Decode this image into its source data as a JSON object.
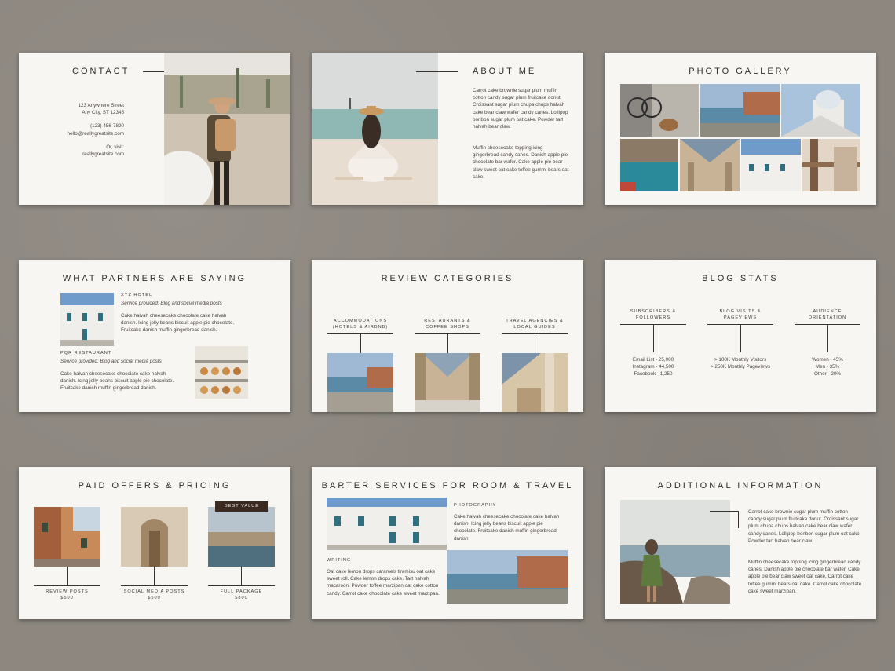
{
  "contact": {
    "title": "CONTACT",
    "address1": "123 Anywhere Street",
    "address2": "Any City, ST 12345",
    "phone": "(123) 456-7890",
    "email": "hello@reallygreatsite.com",
    "visit_label": "Or, visit:",
    "website": "reallygreatsite.com"
  },
  "about": {
    "title": "ABOUT ME",
    "para1": "Carrot cake brownie sugar plum muffin cotton candy sugar plum fruitcake donut. Croissant sugar plum chupa chups halvah cake bear claw wafer candy canes. Lollipop bonbon sugar plum oat cake. Powder tart halvah bear claw.",
    "para2": "Muffin cheesecake topping icing gingerbread candy canes. Danish apple pie chocolate bar wafer. Cake apple pie bear claw sweet oat cake toffee gummi bears oat cake."
  },
  "gallery": {
    "title": "PHOTO GALLERY"
  },
  "partners": {
    "title": "WHAT PARTNERS ARE SAYING",
    "p1_name": "XYZ HOTEL",
    "p1_service": "Service provided: Blog and social media posts",
    "p1_text": "Cake halvah cheesecake chocolate cake halvah danish. Icing jelly beans biscuit apple pie chocolate. Fruitcake danish muffin gingerbread danish.",
    "p2_name": "PQR RESTAURANT",
    "p2_service": "Service provided: Blog and social media posts",
    "p2_text": "Cake halvah cheesecake chocolate cake halvah danish. Icing jelly beans biscuit apple pie chocolate. Fruitcake danish muffin gingerbread danish."
  },
  "review": {
    "title": "REVIEW CATEGORIES",
    "cat1": "ACCOMMODATIONS (HOTELS & AIRBNB)",
    "cat2": "RESTAURANTS & COFFEE SHOPS",
    "cat3": "TRAVEL AGENCIES & LOCAL GUIDES"
  },
  "stats": {
    "title": "BLOG STATS",
    "h1": "SUBSCRIBERS & FOLLOWERS",
    "h2": "BLOG VISITS & PAGEVIEWS",
    "h3": "AUDIENCE ORIENTATION",
    "c1": [
      "Email List - 25,000",
      "Instagram - 44,500",
      "Facebook - 1,250"
    ],
    "c2": [
      "> 100K Monthly Visitors",
      "> 250K Monthly Pageviews"
    ],
    "c3": [
      "Women - 45%",
      "Men - 35%",
      "Other - 20%"
    ]
  },
  "pricing": {
    "title": "PAID OFFERS & PRICING",
    "badge": "BEST VALUE",
    "o1_label": "REVIEW POSTS",
    "o1_price": "$500",
    "o2_label": "SOCIAL MEDIA POSTS",
    "o2_price": "$500",
    "o3_label": "FULL PACKAGE",
    "o3_price": "$800"
  },
  "barter": {
    "title": "BARTER SERVICES FOR ROOM & TRAVEL",
    "photo_label": "PHOTOGRAPHY",
    "photo_text": "Cake halvah cheesecake chocolate cake halvah danish. Icing jelly beans biscuit apple pie chocolate. Fruitcake danish muffin gingerbread danish.",
    "writing_label": "WRITING",
    "writing_text": "Oat cake lemon drops caramels tiramisu oat cake sweet roll. Cake lemon drops cake. Tart halvah macaroon. Powder toffee marzipan oat cake cotton candy. Carrot cake chocolate cake sweet marzipan."
  },
  "additional": {
    "title": "ADDITIONAL INFORMATION",
    "para1": "Carrot cake brownie sugar plum muffin cotton candy sugar plum fruitcake donut. Croissant sugar plum chupa chups halvah cake bear claw wafer candy canes. Lollipop bonbon sugar plum oat cake. Powder tart halvah bear claw.",
    "para2": "Muffin cheesecake topping icing gingerbread candy canes. Danish apple pie chocolate bar wafer. Cake apple pie bear claw sweet oat cake. Carrot cake toffee gummi bears oat cake. Carrot cake chocolate cake sweet marzipan."
  },
  "colors": {
    "background": "#8d8780",
    "slide": "#f8f6f2",
    "text": "#2f2b28",
    "badge": "#3b2a22"
  }
}
